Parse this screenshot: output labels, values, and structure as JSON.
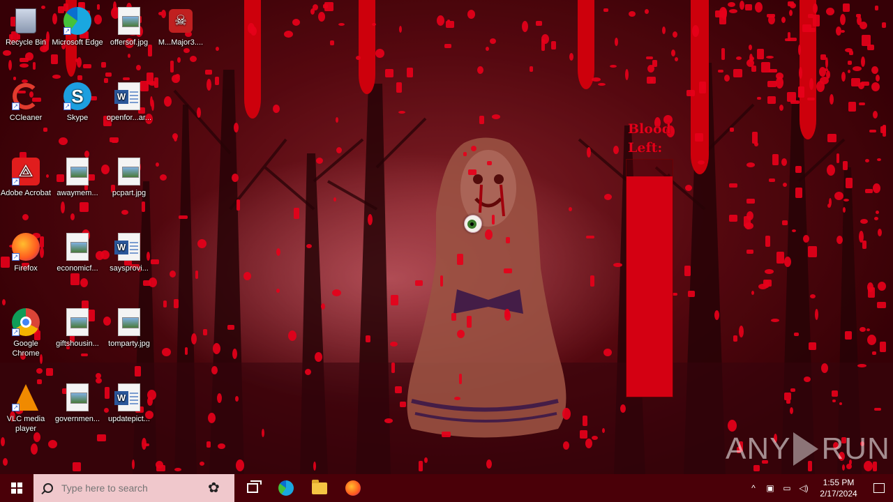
{
  "desktop": {
    "icons": [
      {
        "label": "Recycle Bin",
        "icon": "recycle-bin-icon"
      },
      {
        "label": "Microsoft Edge",
        "icon": "edge-icon"
      },
      {
        "label": "offersof.jpg",
        "icon": "image-file-icon"
      },
      {
        "label": "M...Major3....",
        "icon": "app-icon"
      },
      {
        "label": "CCleaner",
        "icon": "ccleaner-icon"
      },
      {
        "label": "Skype",
        "icon": "skype-icon"
      },
      {
        "label": "openfor...ar...",
        "icon": "word-doc-icon"
      },
      {
        "label": "Adobe Acrobat",
        "icon": "acrobat-icon"
      },
      {
        "label": "awaymem...",
        "icon": "image-file-icon"
      },
      {
        "label": "pcpart.jpg",
        "icon": "image-file-icon"
      },
      {
        "label": "Firefox",
        "icon": "firefox-icon"
      },
      {
        "label": "economicf...",
        "icon": "image-file-icon"
      },
      {
        "label": "saysprovi...",
        "icon": "word-doc-icon"
      },
      {
        "label": "Google Chrome",
        "icon": "chrome-icon"
      },
      {
        "label": "giftshousin...",
        "icon": "image-file-icon"
      },
      {
        "label": "tomparty.jpg",
        "icon": "image-file-icon"
      },
      {
        "label": "VLC media player",
        "icon": "vlc-icon"
      },
      {
        "label": "governmen...",
        "icon": "image-file-icon"
      },
      {
        "label": "updatepict...",
        "icon": "word-doc-icon"
      }
    ]
  },
  "overlay": {
    "blood_label": "Blood Left:",
    "blood_level": 0.93,
    "blood_color": "#d40012"
  },
  "watermark": {
    "left": "ANY",
    "right": "RUN"
  },
  "taskbar": {
    "search_placeholder": "Type here to search",
    "time": "1:55 PM",
    "date": "2/17/2024"
  },
  "colors": {
    "blood": "#e6001a",
    "taskbar": "#4a0008"
  }
}
